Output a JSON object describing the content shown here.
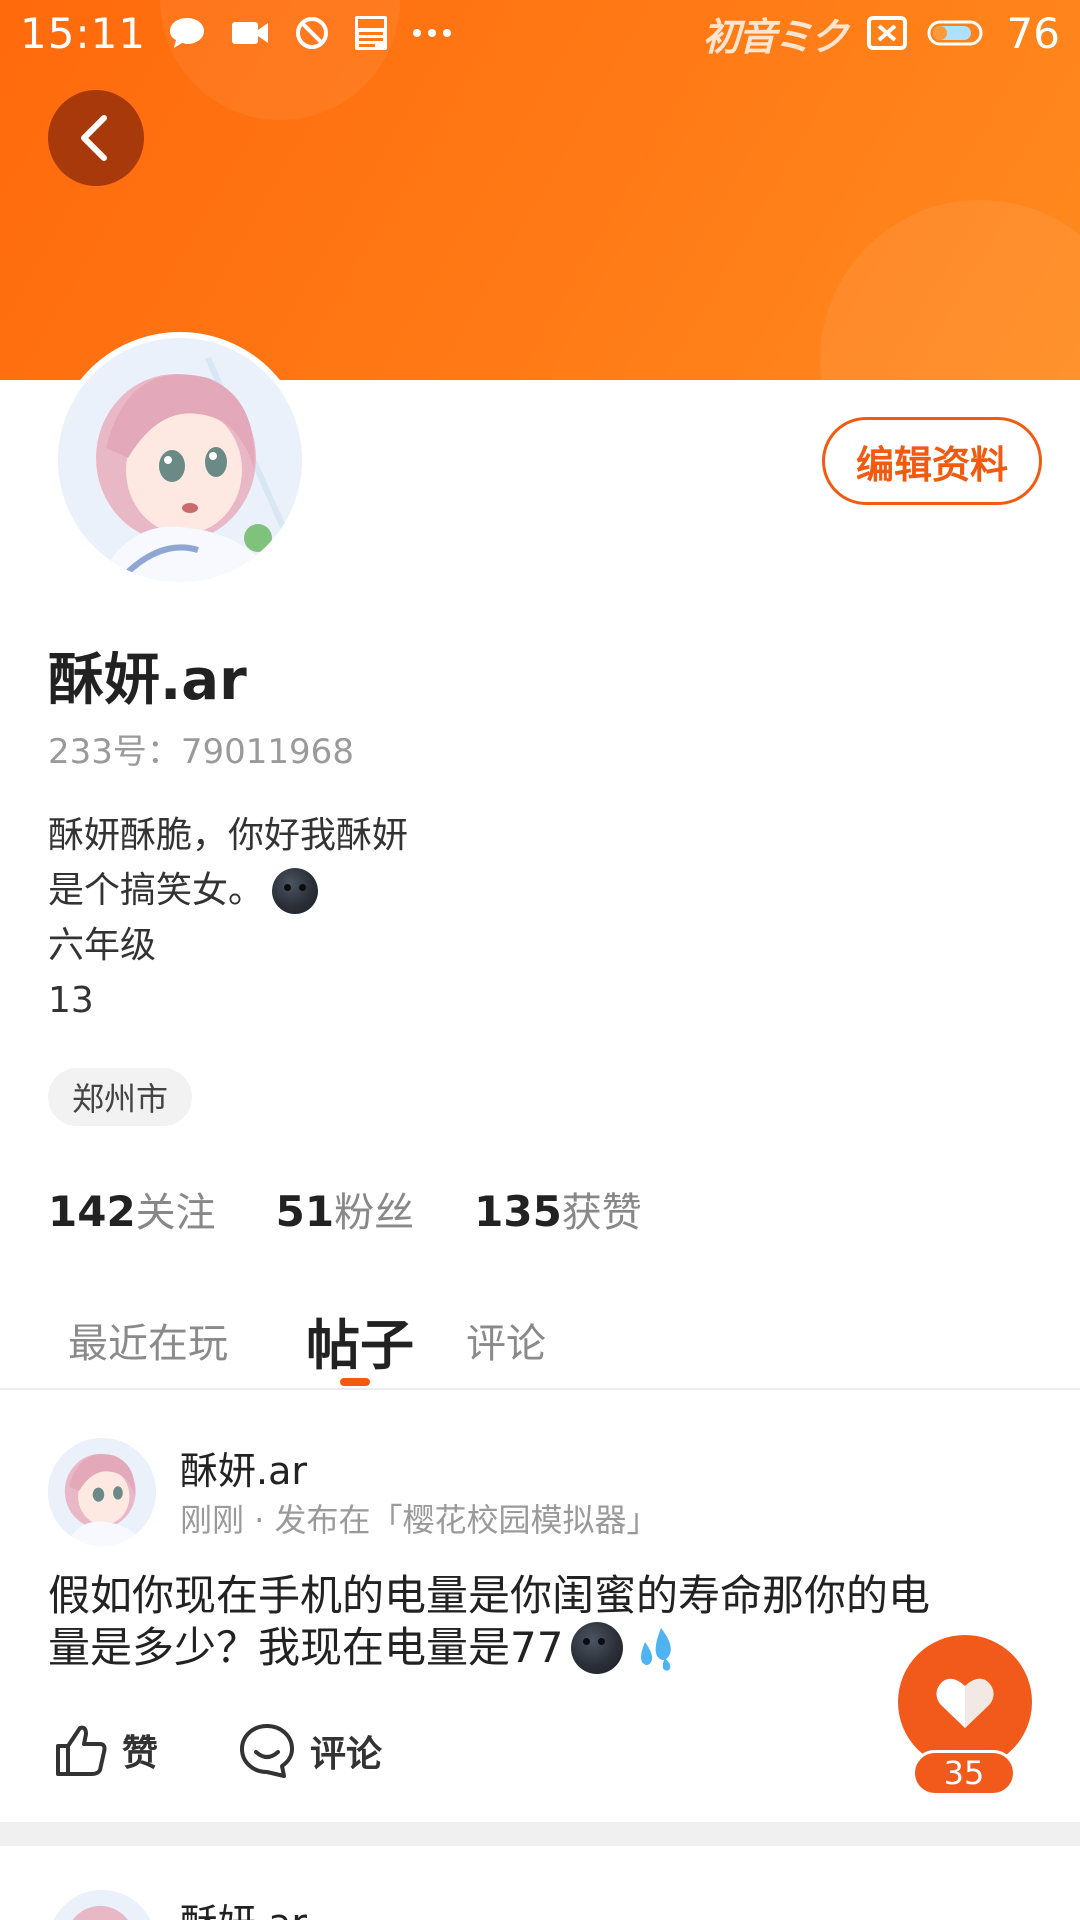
{
  "status_bar": {
    "time": "15:11",
    "brand": "初音ミク",
    "battery": "76",
    "icons": [
      "message-icon",
      "video-icon",
      "dnd-icon",
      "news-icon",
      "more-icon",
      "sim-off-icon",
      "battery-icon"
    ]
  },
  "profile": {
    "edit_label": "编辑资料",
    "name": "酥妍.ar",
    "uid": "233号：79011968",
    "bio": [
      "酥妍酥脆，你好我酥妍",
      "是个搞笑女。",
      "六年级",
      "13"
    ],
    "location": "郑州市",
    "stats": [
      {
        "num": "142",
        "label": "关注"
      },
      {
        "num": "51",
        "label": "粉丝"
      },
      {
        "num": "135",
        "label": "获赞"
      }
    ]
  },
  "tabs": [
    {
      "label": "最近在玩",
      "active": false
    },
    {
      "label": "帖子",
      "active": true
    },
    {
      "label": "评论",
      "active": false
    }
  ],
  "post": {
    "author": "酥妍.ar",
    "meta": "刚刚 · 发布在「樱花校园模拟器」",
    "text_line1": "假如你现在手机的电量是你闺蜜的寿命那你的电",
    "text_line2": "量是多少？我现在电量是77",
    "like_label": "赞",
    "comment_label": "评论",
    "fab_count": "35"
  },
  "next_post": {
    "author": "酥妍.ar"
  },
  "colors": {
    "accent": "#f15a10",
    "header_start": "#ff6a0c",
    "header_end": "#ff8a1e"
  }
}
